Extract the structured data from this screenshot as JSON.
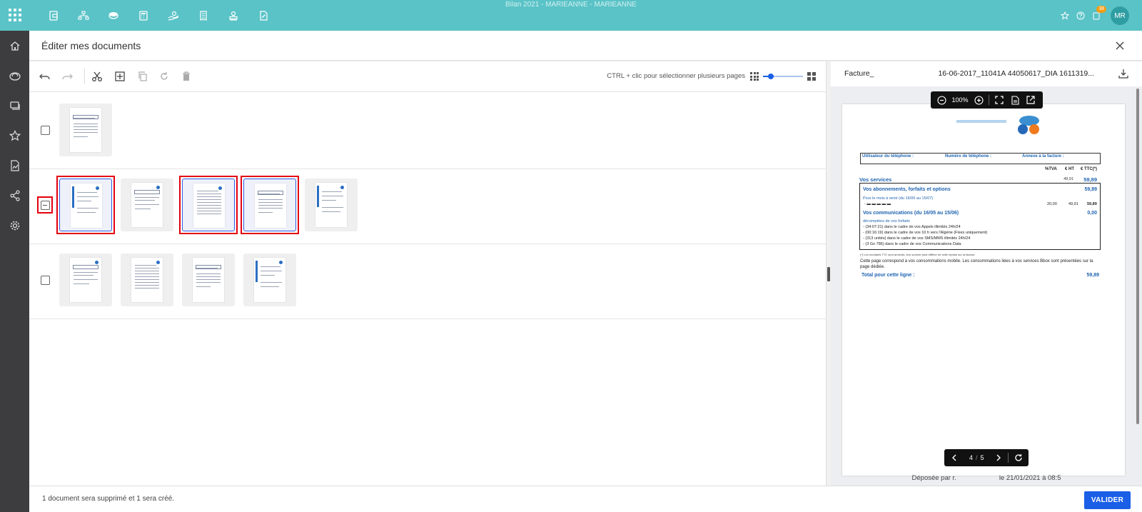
{
  "topbar": {
    "title": "Bilan 2021 - MARIEANNE - MARIEANNE",
    "notification_count": "38",
    "avatar_initials": "MR",
    "bg_color": "#5ac3c7"
  },
  "header": {
    "title": "Éditer mes documents"
  },
  "toolbar": {
    "hint": "CTRL + clic pour sélectionner plusieurs pages",
    "thumb_size_level": 0.2
  },
  "footer": {
    "message": "1 document sera supprimé et 1 sera créé.",
    "validate_label": "VALIDER"
  },
  "preview": {
    "filename_left": "Facture_",
    "filename_right": "16-06-2017_11041A 44050617_DIA 1611319...",
    "zoom": "100%",
    "page_current": "4",
    "page_sep": "/",
    "page_total": "5",
    "deposit_left": "Déposée par r.",
    "deposit_right": "le 21/01/2021 à 08:5"
  },
  "invoice": {
    "col_user": "Utilisateur du téléphone :",
    "col_number": "Numéro de téléphone :",
    "col_annex": "Annexe à la facture :",
    "col_tva": "%TVA",
    "col_ht": "€ HT",
    "col_ttc": "€ TTC(*)",
    "services_label": "Vos services",
    "services_ht": "49,91",
    "services_value": "59,89",
    "subs_title": "Vos abonnements, forfaits et options",
    "subs_value": "59,89",
    "subs_period": "Pour le mois à venir (du 16/06 au 15/07)",
    "subs_line_tva": "20,00",
    "subs_line_ht": "49,91",
    "subs_line_ttc": "59,89",
    "comm_title": "Vos communications (du 16/05 au 15/06)",
    "comm_value": "0,00",
    "comm_sub": "décomptées de vos forfaits",
    "comm_lines": [
      "- (34:07:21) dans le cadre de vos Appels illimités 24h/24",
      "- (00:16:19) dans le cadre de vos 10 h vers l'Algérie (Fixes uniquement)",
      "- (313 unités) dans le cadre de vos SMS/MMS illimités 24h/24",
      "- (3 Go 786) dans le cadre de vos Communications Data"
    ],
    "note": "(*) Les montants TTC sont arrondis, leur somme peut différer de celle reprise sur la facture.",
    "para": "Cette page correspond à vos consommations mobile. Les consommations liées à vos services Bbox sont présentées sur la page dédiée.",
    "total_label": "Total pour cette ligne :",
    "total_value": "59,89"
  },
  "documents": [
    {
      "checkbox": "unchecked",
      "pages": [
        {
          "selected": false,
          "highlighted": false
        }
      ]
    },
    {
      "checkbox": "indeterminate",
      "checkbox_highlighted": true,
      "pages": [
        {
          "selected": true,
          "highlighted": true
        },
        {
          "selected": false,
          "highlighted": false
        },
        {
          "selected": true,
          "highlighted": true
        },
        {
          "selected": true,
          "highlighted": true
        },
        {
          "selected": false,
          "highlighted": false
        }
      ]
    },
    {
      "checkbox": "unchecked",
      "pages": [
        {
          "selected": false,
          "highlighted": false
        },
        {
          "selected": false,
          "highlighted": false
        },
        {
          "selected": false,
          "highlighted": false
        },
        {
          "selected": false,
          "highlighted": false
        }
      ]
    }
  ],
  "colors": {
    "accent": "#1a5fe6",
    "highlight": "#e3000f",
    "rail": "#3d3d3f"
  }
}
